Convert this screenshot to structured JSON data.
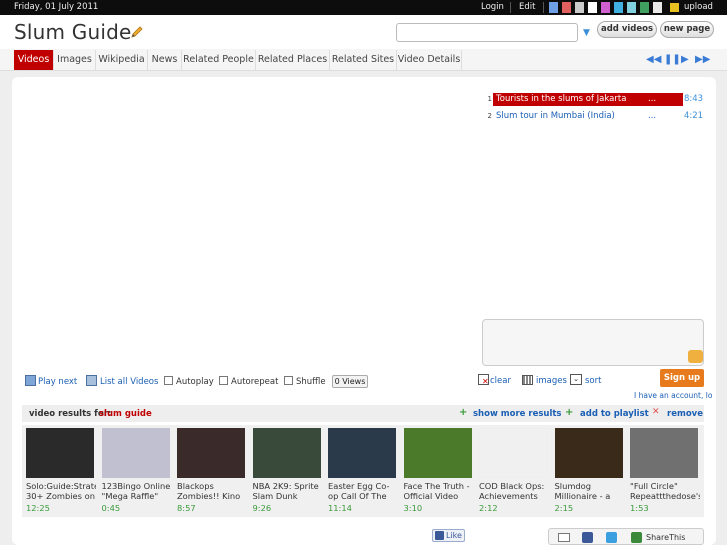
{
  "topbar": {
    "date": "Friday, 01 July 2011",
    "login": "Login",
    "edit": "Edit",
    "swatches": [
      "#6ea0e8",
      "#e06060",
      "#cccccc",
      "#ffffff",
      "#d060d0",
      "#40b0e0",
      "#80d0e0",
      "#40a060",
      "#e8e8e8"
    ],
    "upload": "upload"
  },
  "header": {
    "title": "Slum Guide",
    "search_value": "",
    "add_videos": "add videos",
    "new_page": "new page"
  },
  "tabs": [
    "Videos",
    "Images",
    "Wikipedia",
    "News",
    "Related People",
    "Related Places",
    "Related Sites",
    "Video Details"
  ],
  "player_controls": [
    "rewind-icon",
    "pause-icon",
    "play-icon",
    "fast-forward-icon"
  ],
  "playlist": [
    {
      "num": "1",
      "title": "Tourists in the slums of Jakarta",
      "dots": "...",
      "duration": "8:43",
      "selected": true
    },
    {
      "num": "2",
      "title": "Slum tour in Mumbai (India)",
      "dots": "...",
      "duration": "4:21",
      "selected": false
    }
  ],
  "controls": {
    "play_next": "Play next",
    "list_all": "List all Videos",
    "autoplay": "Autoplay",
    "autorepeat": "Autorepeat",
    "shuffle": "Shuffle",
    "views": "0 Views",
    "clear": "clear",
    "images": "images",
    "sort": "sort",
    "signup": "Sign up",
    "account": "I have an account, lo"
  },
  "results": {
    "label": "video results for:",
    "query": "slum guide",
    "show_more": "show more results",
    "add_playlist": "add to playlist",
    "remove": "remove"
  },
  "videos": [
    {
      "title": "Solo:Guide:Strate 30+ Zombies on",
      "duration": "12:25",
      "thumb": "#2a2a2a"
    },
    {
      "title": "123Bingo Online \"Mega Raffle\"",
      "duration": "0:45",
      "thumb": "#c0c0d0"
    },
    {
      "title": "Blackops Zombies!! Kino",
      "duration": "8:57",
      "thumb": "#3a2a2a"
    },
    {
      "title": "NBA 2K9: Sprite Slam Dunk",
      "duration": "9:26",
      "thumb": "#3a4a3a"
    },
    {
      "title": "Easter Egg Co-op Call Of The",
      "duration": "11:14",
      "thumb": "#2a3a4a"
    },
    {
      "title": "Face The Truth - Official Video",
      "duration": "3:10",
      "thumb": "#4a7a2a"
    },
    {
      "title": "COD Black Ops: Achievements",
      "duration": "2:12",
      "thumb": "#f0f0f0"
    },
    {
      "title": "Slumdog Millionaire - a",
      "duration": "2:15",
      "thumb": "#3a2a1a"
    },
    {
      "title": "\"Full Circle\" Repeattthedose's",
      "duration": "1:53",
      "thumb": "#707070"
    }
  ],
  "footer": {
    "like": "Like",
    "share": "ShareThis"
  }
}
